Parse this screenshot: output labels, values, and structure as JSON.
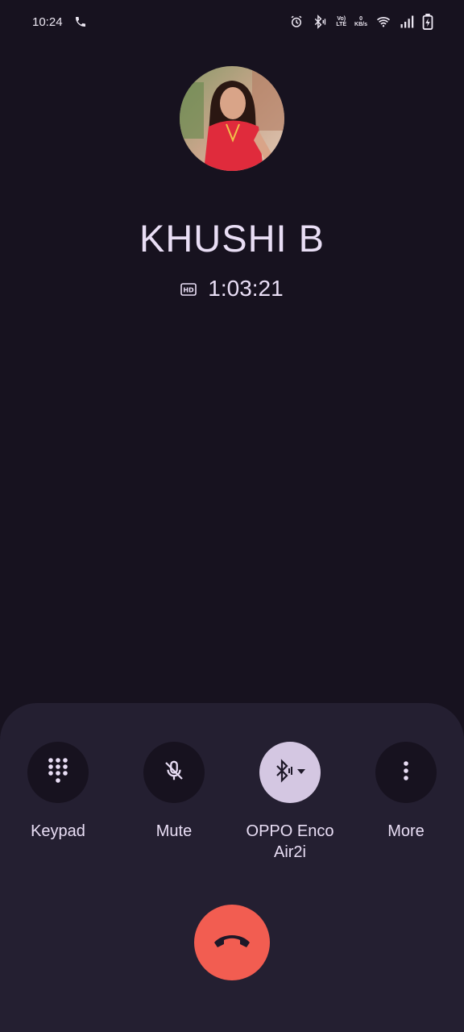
{
  "status_bar": {
    "time": "10:24",
    "volte_top": "Vo)",
    "volte_bottom": "LTE",
    "net_speed_value": "0",
    "net_speed_unit": "KB/s"
  },
  "contact": {
    "name": "KHUSHI B",
    "hd_badge": "HD",
    "call_duration": "1:03:21"
  },
  "actions": {
    "keypad_label": "Keypad",
    "mute_label": "Mute",
    "audio_label": "OPPO Enco Air2i",
    "more_label": "More"
  },
  "colors": {
    "background": "#17121f",
    "sheet": "#241f31",
    "active_button": "#d4c7e2",
    "end_call": "#f25d51"
  }
}
